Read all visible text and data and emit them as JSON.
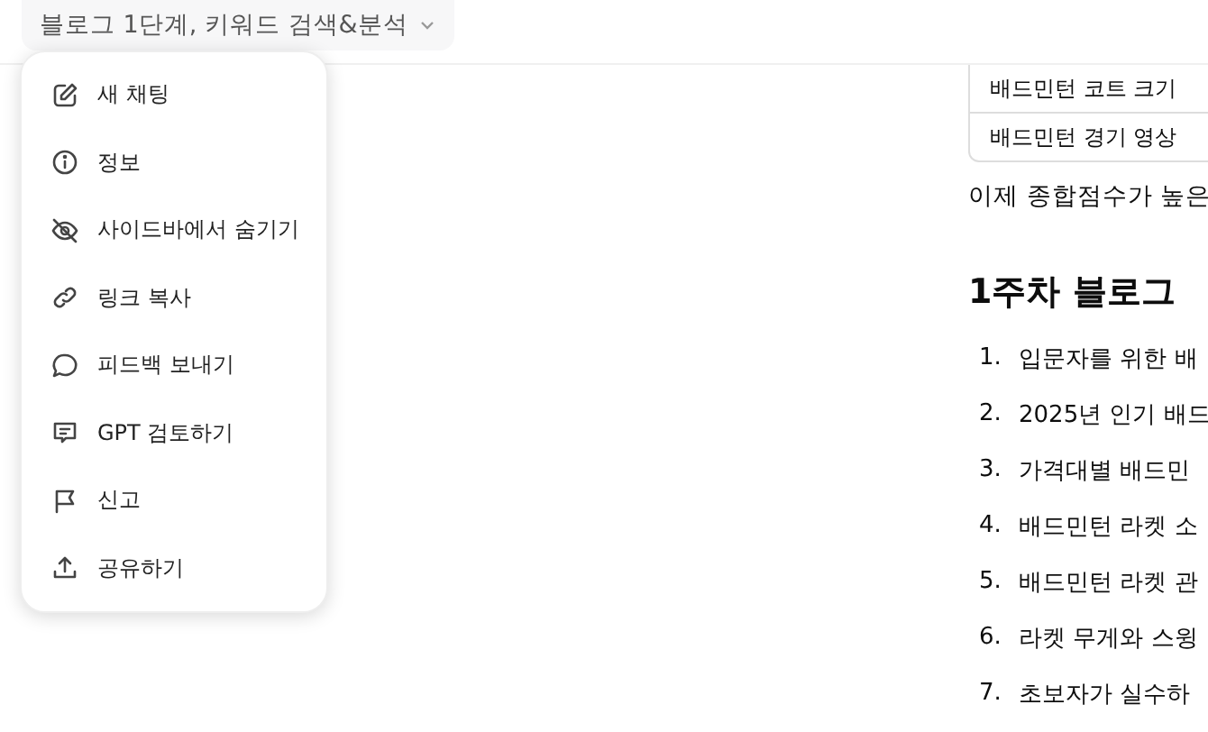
{
  "title": "블로그 1단계, 키워드 검색&분석",
  "menu": [
    {
      "label": "새 채팅"
    },
    {
      "label": "정보"
    },
    {
      "label": "사이드바에서 숨기기"
    },
    {
      "label": "링크 복사"
    },
    {
      "label": "피드백 보내기"
    },
    {
      "label": "GPT 검토하기"
    },
    {
      "label": "신고"
    },
    {
      "label": "공유하기"
    }
  ],
  "table": {
    "rows": [
      [
        "배드민턴 코트 크기"
      ],
      [
        "배드민턴 경기 영상"
      ]
    ]
  },
  "paragraph": "이제 종합점수가 높은",
  "heading": "1주차 블로그",
  "list": [
    {
      "number": "1.",
      "text": "입문자를 위한 배"
    },
    {
      "number": "2.",
      "text": "2025년 인기 배드"
    },
    {
      "number": "3.",
      "text": "가격대별 배드민"
    },
    {
      "number": "4.",
      "text": "배드민턴 라켓 소"
    },
    {
      "number": "5.",
      "text": "배드민턴 라켓 관"
    },
    {
      "number": "6.",
      "text": "라켓 무게와 스윙"
    },
    {
      "number": "7.",
      "text": "초보자가 실수하"
    }
  ]
}
